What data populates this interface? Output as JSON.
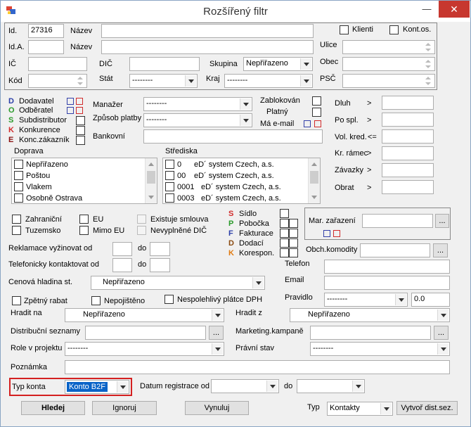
{
  "window": {
    "title": "Rozšířený filtr",
    "minimize": "—",
    "close": "✕"
  },
  "header": {
    "id_label": "Id.",
    "id_value": "27316",
    "nazev_label": "Název",
    "nazev_value": "",
    "klienti_label": "Klienti",
    "kontos_label": "Kont.os.",
    "ida_label": "Id.A.",
    "nazev2_label": "Název",
    "ulice_label": "Ulice",
    "ic_label": "IČ",
    "dic_label": "DIČ",
    "skupina_label": "Skupina",
    "skupina_value": "Nepřiřazeno",
    "obec_label": "Obec",
    "kod_label": "Kód",
    "stat_label": "Stát",
    "stat_value": "--------",
    "kraj_label": "Kraj",
    "kraj_value": "--------",
    "psc_label": "PSČ"
  },
  "roles": {
    "items": [
      {
        "letter": "D",
        "label": "Dodavatel",
        "color": "#2b3fa8"
      },
      {
        "letter": "O",
        "label": "Odběratel",
        "color": "#2a9a2a"
      },
      {
        "letter": "S",
        "label": "Subdistributor",
        "color": "#2a9a2a"
      },
      {
        "letter": "K",
        "label": "Konkurence",
        "color": "#d12b2b"
      },
      {
        "letter": "E",
        "label": "Konc.zákazník",
        "color": "#8a1010"
      }
    ]
  },
  "mid": {
    "manazer_label": "Manažer",
    "manazer_value": "--------",
    "zpusob_label": "Způsob platby",
    "zpusob_value": "--------",
    "bankovni_label": "Bankovní",
    "zablokovan_label": "Zablokován",
    "platny_label": "Platný",
    "mail_label": "Má e-mail"
  },
  "finance": {
    "items": [
      {
        "label": "Dluh",
        "op": ">"
      },
      {
        "label": "Po spl.",
        "op": ">"
      },
      {
        "label": "Vol. kred.",
        "op": "<="
      },
      {
        "label": "Kr. rámec",
        "op": ">"
      },
      {
        "label": "Závazky",
        "op": ">"
      },
      {
        "label": "Obrat",
        "op": ">"
      }
    ]
  },
  "doprava": {
    "label": "Doprava",
    "items": [
      "Nepřiřazeno",
      "Poštou",
      "Vlakem",
      "Osobně Ostrava"
    ]
  },
  "strediska": {
    "label": "Střediska",
    "items": [
      {
        "code": "0",
        "name": "eD´ system Czech, a.s."
      },
      {
        "code": "00",
        "name": "eD´ system Czech, a.s."
      },
      {
        "code": "0001",
        "name": "eD´ system Czech, a.s."
      },
      {
        "code": "0003",
        "name": "eD´ system Czech, a.s."
      }
    ]
  },
  "flags": {
    "zahranicni": "Zahraniční",
    "eu": "EU",
    "existuje": "Existuje smlouva",
    "tuzemsko": "Tuzemsko",
    "mimo_eu": "Mimo EU",
    "nevyplnene": "Nevyplněné DIČ"
  },
  "addresses": {
    "items": [
      {
        "letter": "S",
        "label": "Sídlo",
        "color": "#d12b2b"
      },
      {
        "letter": "P",
        "label": "Pobočka",
        "color": "#2a9a2a"
      },
      {
        "letter": "F",
        "label": "Fakturace",
        "color": "#2b3fa8"
      },
      {
        "letter": "D",
        "label": "Dodací",
        "color": "#8a4a10"
      },
      {
        "letter": "K",
        "label": "Korespon.",
        "color": "#e07a10"
      }
    ]
  },
  "mar": {
    "label": "Mar. zařazení",
    "btn": "..."
  },
  "reklamace": {
    "label": "Reklamace vyžinovat od",
    "do": "do"
  },
  "telefon_kontakt": {
    "label": "Telefonicky kontaktovat od",
    "do": "do"
  },
  "obch": {
    "label": "Obch.komodity",
    "btn": "..."
  },
  "telefon_label": "Telefon",
  "email_label": "Email",
  "pravidlo": {
    "label": "Pravidlo",
    "value": "--------",
    "num": "0.0"
  },
  "cenova": {
    "label": "Cenová hladina st.",
    "value": "Nepřiřazeno"
  },
  "zpetny": "Zpětný rabat",
  "nepojisteno": "Nepojištěno",
  "nespolehlivy": "Nespolehlivý plátce DPH",
  "hradit_na": {
    "label": "Hradit na",
    "value": "Nepřiřazeno"
  },
  "hradit_z": {
    "label": "Hradit z",
    "value": "Nepřiřazeno"
  },
  "distribucni": {
    "label": "Distribuční seznamy",
    "btn": "..."
  },
  "marketing": {
    "label": "Marketing.kampaně",
    "btn": "..."
  },
  "role": {
    "label": "Role v projektu",
    "value": "--------"
  },
  "pravni": {
    "label": "Právní stav",
    "value": "--------"
  },
  "poznamka_label": "Poznámka",
  "typ_konta": {
    "label": "Typ konta",
    "value": "Konto B2F"
  },
  "datum": {
    "label": "Datum registrace od",
    "do": "do"
  },
  "buttons": {
    "hledej": "Hledej",
    "ignoruj": "Ignoruj",
    "vynuluj": "Vynuluj",
    "vytvor": "Vytvoř dist.sez."
  },
  "typ": {
    "label": "Typ",
    "value": "Kontakty"
  }
}
